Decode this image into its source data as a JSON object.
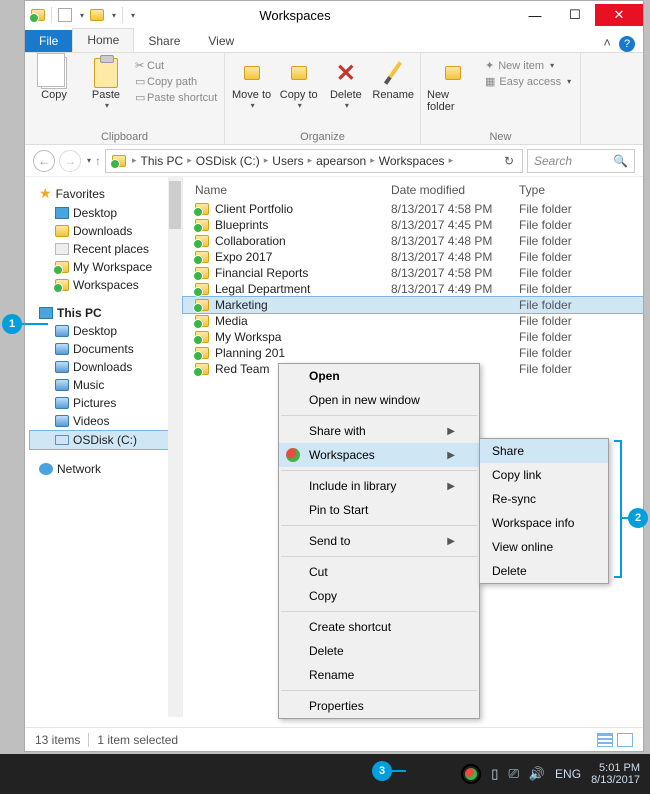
{
  "window": {
    "title": "Workspaces"
  },
  "tabs": {
    "file": "File",
    "home": "Home",
    "share": "Share",
    "view": "View"
  },
  "ribbon": {
    "clipboard": {
      "label": "Clipboard",
      "copy": "Copy",
      "paste": "Paste",
      "cut": "Cut",
      "copy_path": "Copy path",
      "paste_shortcut": "Paste shortcut"
    },
    "organize": {
      "label": "Organize",
      "move_to": "Move to",
      "copy_to": "Copy to",
      "delete": "Delete",
      "rename": "Rename"
    },
    "new": {
      "label": "New",
      "new_folder": "New folder",
      "new_item": "New item",
      "easy_access": "Easy access"
    }
  },
  "breadcrumbs": [
    "This PC",
    "OSDisk (C:)",
    "Users",
    "apearson",
    "Workspaces"
  ],
  "search_placeholder": "Search",
  "tree": {
    "favorites": "Favorites",
    "fav_items": [
      "Desktop",
      "Downloads",
      "Recent places",
      "My Workspace",
      "Workspaces"
    ],
    "this_pc": "This PC",
    "pc_items": [
      "Desktop",
      "Documents",
      "Downloads",
      "Music",
      "Pictures",
      "Videos",
      "OSDisk (C:)"
    ],
    "network": "Network"
  },
  "columns": {
    "name": "Name",
    "date": "Date modified",
    "type": "Type"
  },
  "rows": [
    {
      "name": "Client Portfolio",
      "date": "8/13/2017 4:58 PM",
      "type": "File folder"
    },
    {
      "name": "Blueprints",
      "date": "8/13/2017 4:45 PM",
      "type": "File folder"
    },
    {
      "name": "Collaboration",
      "date": "8/13/2017 4:48 PM",
      "type": "File folder"
    },
    {
      "name": "Expo 2017",
      "date": "8/13/2017 4:48 PM",
      "type": "File folder"
    },
    {
      "name": "Financial Reports",
      "date": "8/13/2017 4:58 PM",
      "type": "File folder"
    },
    {
      "name": "Legal Department",
      "date": "8/13/2017 4:49 PM",
      "type": "File folder"
    },
    {
      "name": "Marketing",
      "date": "",
      "type": "File folder",
      "selected": true
    },
    {
      "name": "Media",
      "date": "",
      "type": "File folder"
    },
    {
      "name": "My Workspa",
      "date": "",
      "type": "File folder"
    },
    {
      "name": "Planning 201",
      "date": "",
      "type": "File folder"
    },
    {
      "name": "Red Team",
      "date": "",
      "type": "File folder"
    }
  ],
  "context_menu": {
    "open": "Open",
    "open_new": "Open in new window",
    "share_with": "Share with",
    "workspaces": "Workspaces",
    "include": "Include in library",
    "pin": "Pin to Start",
    "send_to": "Send to",
    "cut": "Cut",
    "copy": "Copy",
    "shortcut": "Create shortcut",
    "delete": "Delete",
    "rename": "Rename",
    "properties": "Properties"
  },
  "sub_menu": {
    "share": "Share",
    "copy_link": "Copy link",
    "resync": "Re-sync",
    "info": "Workspace info",
    "view_online": "View online",
    "delete": "Delete"
  },
  "status": {
    "count": "13 items",
    "selected": "1 item selected"
  },
  "taskbar": {
    "lang": "ENG",
    "time": "5:01 PM",
    "date": "8/13/2017"
  },
  "callouts": {
    "c1": "1",
    "c2": "2",
    "c3": "3"
  }
}
